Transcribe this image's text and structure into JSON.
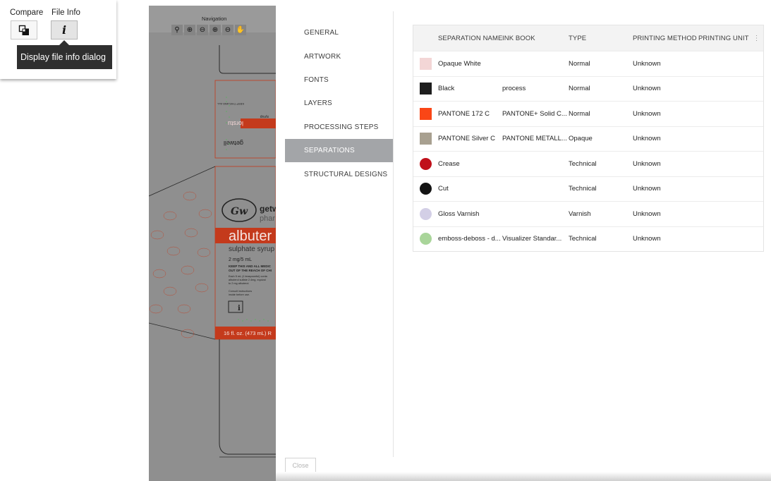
{
  "toolbar": {
    "compare_label": "Compare",
    "fileinfo_label": "File Info",
    "fileinfo_glyph": "i",
    "tooltip": "Display file info dialog"
  },
  "navigation": {
    "title": "Navigation",
    "tools": [
      {
        "icon": "zoom-icon",
        "glyph": "⚲"
      },
      {
        "icon": "zoom-in-icon",
        "glyph": "⊕"
      },
      {
        "icon": "zoom-out-icon",
        "glyph": "⊖"
      },
      {
        "icon": "zoom-fit-icon",
        "glyph": "⊕"
      },
      {
        "icon": "zoom-actual-icon",
        "glyph": "⊖"
      },
      {
        "icon": "pan-hand-icon",
        "glyph": "✋"
      }
    ]
  },
  "artwork": {
    "brand": "getwell",
    "brand_sub": "pharma",
    "product": "albuterol",
    "product_visible": "albuter",
    "subtitle": "sulphate syrup",
    "dose": "2 mg/5 mL",
    "warning": "KEEP THIS AND ALL MEDIC OUT OF THE REACH OF CHI",
    "volume": "16 fl. oz. (473 mL) R",
    "info_icon": "book-info-icon"
  },
  "dialog": {
    "nav_items": [
      {
        "label": "General",
        "selected": false
      },
      {
        "label": "Artwork",
        "selected": false
      },
      {
        "label": "Fonts",
        "selected": false
      },
      {
        "label": "Layers",
        "selected": false
      },
      {
        "label": "Processing Steps",
        "selected": false
      },
      {
        "label": "Separations",
        "selected": true
      },
      {
        "label": "Structural Designs",
        "selected": false
      }
    ],
    "close_label": "Close",
    "table": {
      "headers": [
        "Separation Name",
        "Ink Book",
        "Type",
        "Printing Method",
        "Printing Unit"
      ],
      "rows": [
        {
          "name": "Opaque White",
          "ink_book": "",
          "type": "Normal",
          "method": "Unknown",
          "unit": "",
          "color": "#f3d6d6",
          "shape": "square"
        },
        {
          "name": "Black",
          "ink_book": "process",
          "type": "Normal",
          "method": "Unknown",
          "unit": "",
          "color": "#1e1e1e",
          "shape": "square"
        },
        {
          "name": "PANTONE 172 C",
          "ink_book": "PANTONE+ Solid C...",
          "type": "Normal",
          "method": "Unknown",
          "unit": "",
          "color": "#fa4616",
          "shape": "square"
        },
        {
          "name": "PANTONE Silver C",
          "ink_book": "PANTONE METALL...",
          "type": "Opaque",
          "method": "Unknown",
          "unit": "",
          "color": "#a8a090",
          "shape": "square"
        },
        {
          "name": "Crease",
          "ink_book": "",
          "type": "Technical",
          "method": "Unknown",
          "unit": "",
          "color": "#c0101a",
          "shape": "circle"
        },
        {
          "name": "Cut",
          "ink_book": "",
          "type": "Technical",
          "method": "Unknown",
          "unit": "",
          "color": "#141414",
          "shape": "circle"
        },
        {
          "name": "Gloss Varnish",
          "ink_book": "",
          "type": "Varnish",
          "method": "Unknown",
          "unit": "",
          "color": "#d3cfe6",
          "shape": "circle"
        },
        {
          "name": "emboss-deboss - d...",
          "ink_book": "Visualizer Standar...",
          "type": "Technical",
          "method": "Unknown",
          "unit": "",
          "color": "#a9d59a",
          "shape": "circle"
        }
      ]
    }
  },
  "colors": {
    "accent_selected": "#a3a5a8",
    "product_red": "#c43a1c",
    "viewer_bg": "#8f8f8f"
  }
}
